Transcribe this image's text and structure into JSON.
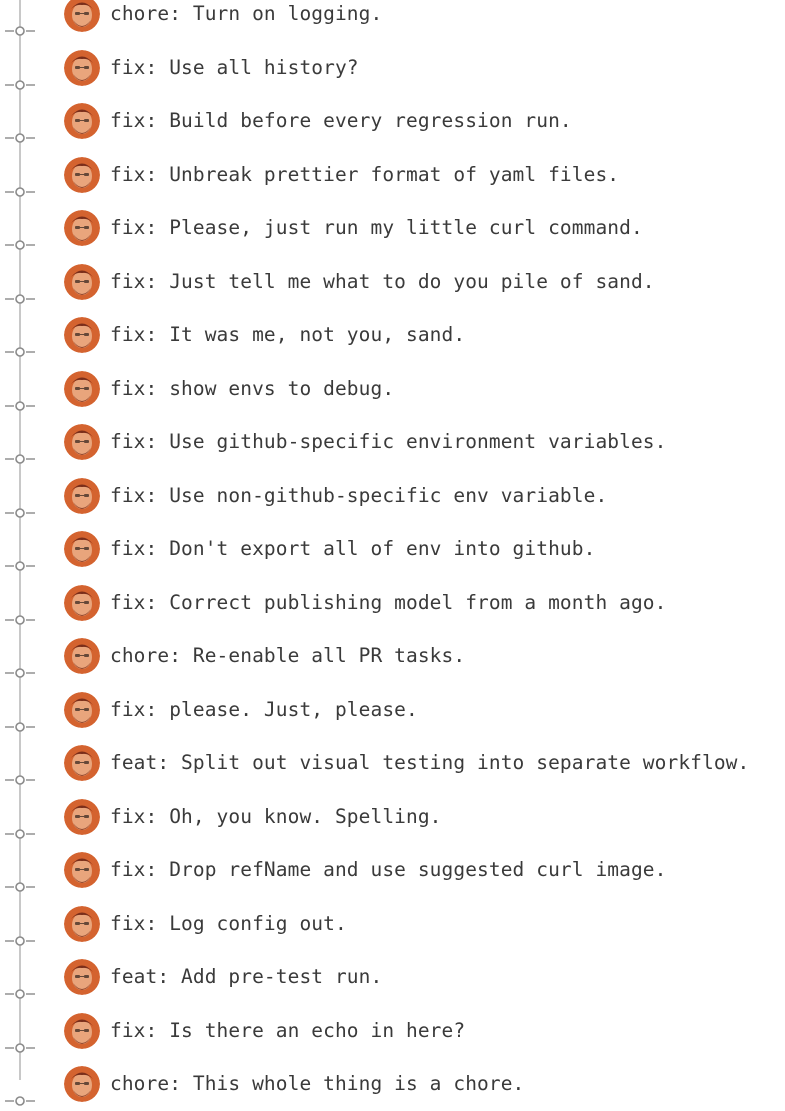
{
  "commit_history": {
    "commits": [
      {
        "message": "chore: Turn on logging."
      },
      {
        "message": "fix: Use all history?"
      },
      {
        "message": "fix: Build before every regression run."
      },
      {
        "message": "fix: Unbreak prettier format of yaml files."
      },
      {
        "message": "fix: Please, just run my little curl command."
      },
      {
        "message": "fix: Just tell me what to do you pile of sand."
      },
      {
        "message": "fix: It was me, not you, sand."
      },
      {
        "message": "fix: show envs to debug."
      },
      {
        "message": "fix: Use github-specific environment variables."
      },
      {
        "message": "fix: Use non-github-specific env variable."
      },
      {
        "message": "fix: Don't export all of env into github."
      },
      {
        "message": "fix: Correct publishing model from a month ago."
      },
      {
        "message": "chore: Re-enable all PR tasks."
      },
      {
        "message": "fix: please. Just, please."
      },
      {
        "message": "feat: Split out visual testing into separate workflow."
      },
      {
        "message": "fix: Oh, you know. Spelling."
      },
      {
        "message": "fix: Drop refName and use suggested curl image."
      },
      {
        "message": "fix: Log config out."
      },
      {
        "message": "feat: Add pre-test run."
      },
      {
        "message": "fix: Is there an echo in here?"
      },
      {
        "message": "chore: This whole thing is a chore."
      }
    ]
  },
  "colors": {
    "text": "#3a3a3a",
    "timeline": "#c8c8c8",
    "node": "#8a8a8a",
    "avatar_bg": "#d4632f",
    "avatar_face": "#e9a57c",
    "avatar_hair": "#7a2e1a"
  },
  "icons": {
    "graph_node": "commit-node-icon",
    "avatar": "author-avatar"
  }
}
